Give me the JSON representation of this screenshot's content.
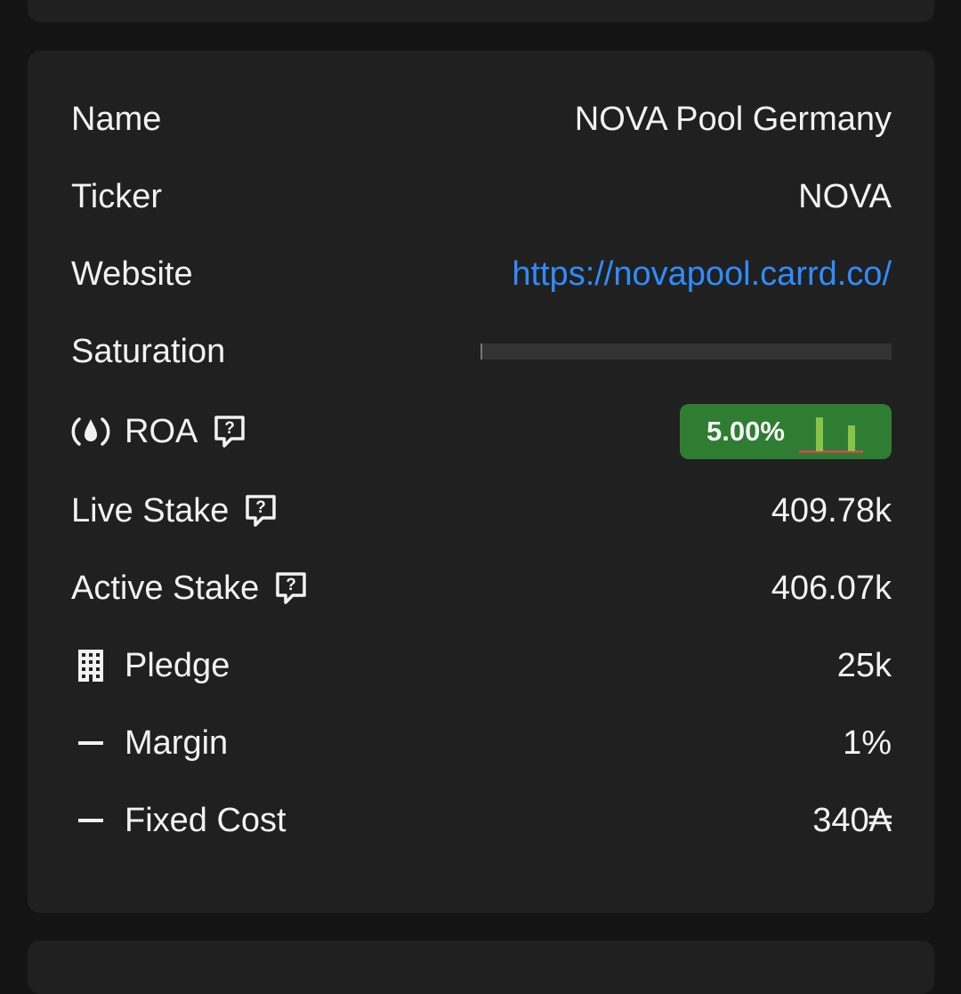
{
  "pool": {
    "name_label": "Name",
    "name_value": "NOVA Pool Germany",
    "ticker_label": "Ticker",
    "ticker_value": "NOVA",
    "website_label": "Website",
    "website_value": "https://novapool.carrd.co/",
    "saturation_label": "Saturation",
    "saturation_fraction": 0.005,
    "roa_label": "ROA",
    "roa_value": "5.00%",
    "live_stake_label": "Live Stake",
    "live_stake_value": "409.78k",
    "active_stake_label": "Active Stake",
    "active_stake_value": "406.07k",
    "pledge_label": "Pledge",
    "pledge_value": "25k",
    "margin_label": "Margin",
    "margin_value": "1%",
    "fixed_cost_label": "Fixed Cost",
    "fixed_cost_value": "340₳"
  },
  "colors": {
    "background": "#141414",
    "card": "#202020",
    "text": "#f2f2f2",
    "link": "#2f8cff",
    "roa_badge": "#2e7d32",
    "sparkline_green": "#8bc34a",
    "sparkline_red": "#c0504d"
  },
  "icons": {
    "roa": "roa-drop-icon",
    "help": "help-bubble-icon",
    "pledge": "building-icon",
    "margin": "dash-icon",
    "fixed_cost": "dash-icon"
  }
}
